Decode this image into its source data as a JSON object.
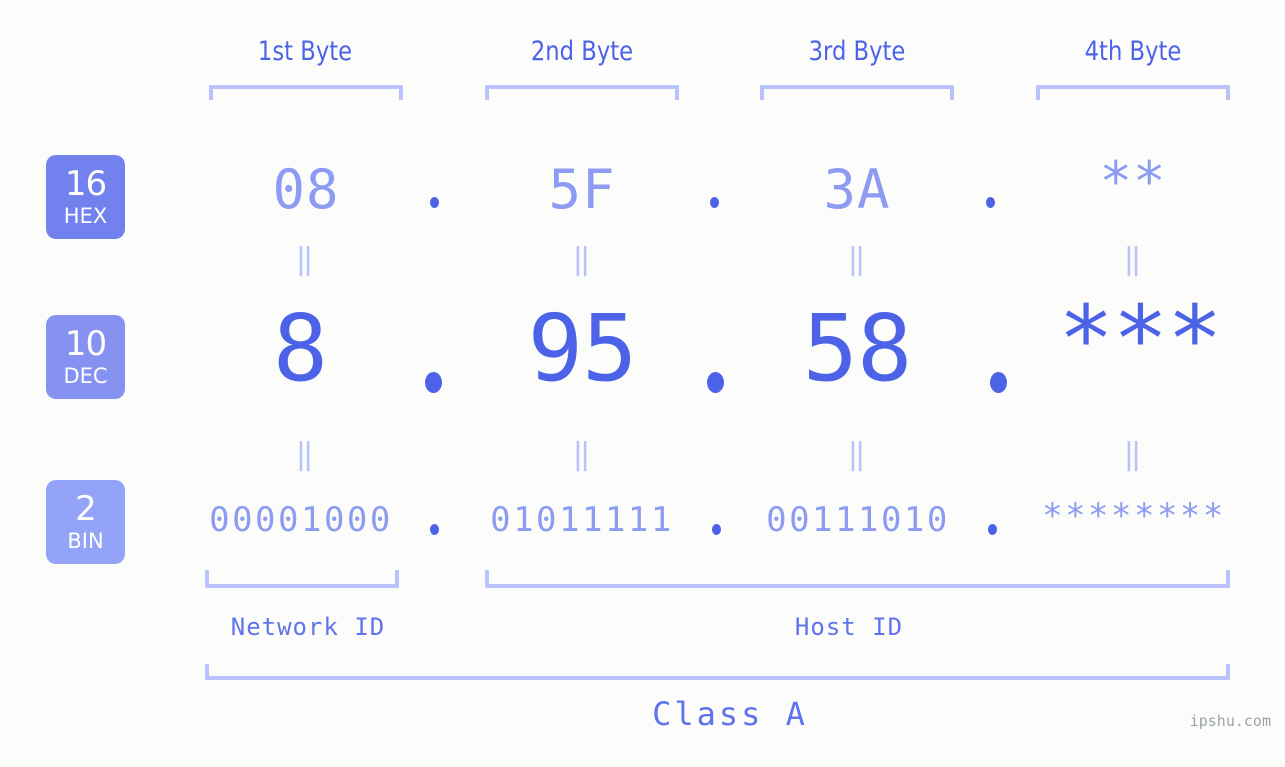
{
  "background_color": "#fcfdfa",
  "accent_strong": "#4c63e8",
  "accent_light": "#8d9bf2",
  "accent_pale": "#b9c2fb",
  "byte_headers": [
    {
      "label": "1st Byte"
    },
    {
      "label": "2nd Byte"
    },
    {
      "label": "3rd Byte"
    },
    {
      "label": "4th Byte"
    }
  ],
  "rows": {
    "hex": {
      "badge_number": "16",
      "badge_name": "HEX",
      "badge_color": "#7182ef",
      "values": [
        "08",
        "5F",
        "3A",
        "**"
      ],
      "separator": "."
    },
    "dec": {
      "badge_number": "10",
      "badge_name": "DEC",
      "badge_color": "#8592f2",
      "values": [
        "8",
        "95",
        "58",
        "***"
      ],
      "separator": "."
    },
    "bin": {
      "badge_number": "2",
      "badge_name": "BIN",
      "badge_color": "#93a3f7",
      "values": [
        "00001000",
        "01011111",
        "00111010",
        "********"
      ],
      "separator": "."
    }
  },
  "equals_separator": "‖",
  "segments": {
    "network_id": "Network ID",
    "host_id": "Host ID"
  },
  "class_label": "Class A",
  "watermark": "ipshu.com"
}
